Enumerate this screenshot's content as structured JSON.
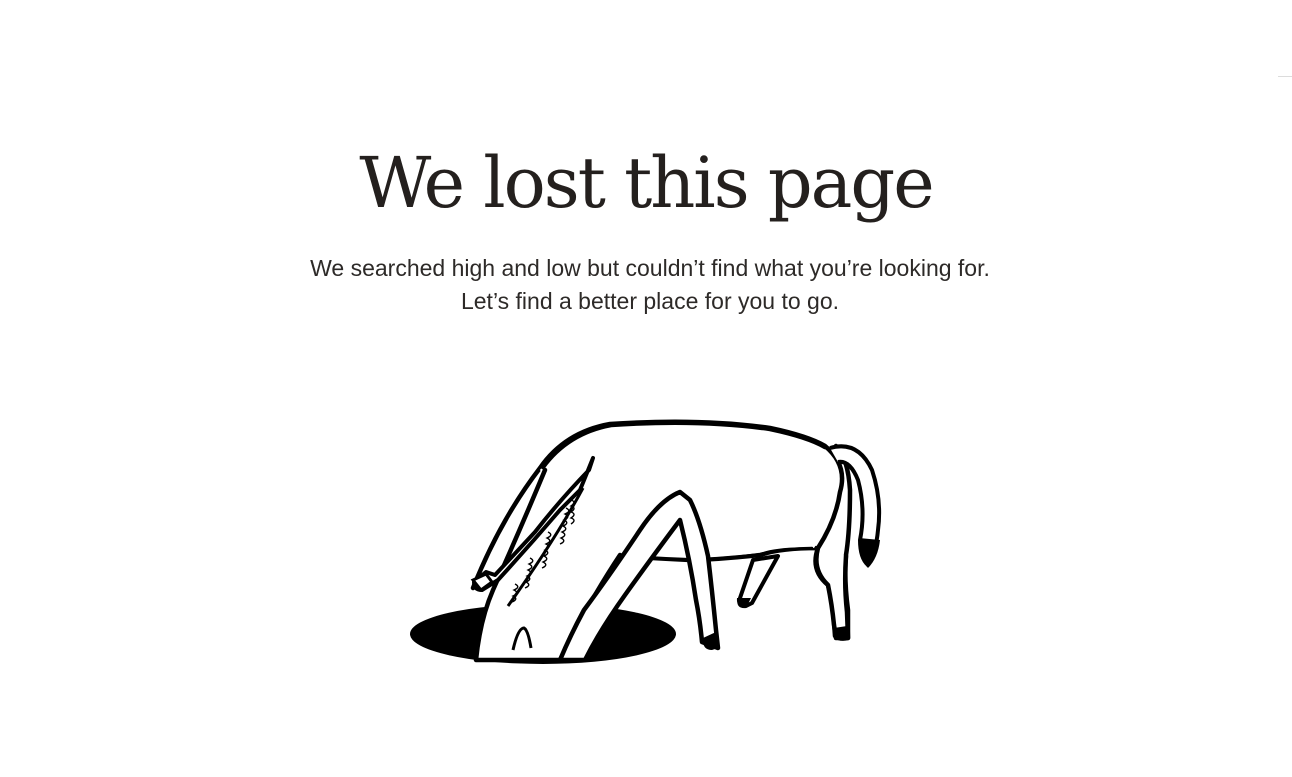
{
  "page": {
    "title": "We lost this page",
    "message": "We searched high and low but couldn’t find what you’re looking for. Let’s find a better place for you to go."
  },
  "illustration": {
    "icon": "anteater-in-hole-illustration",
    "ink_color": "#000000",
    "fill_color": "#ffffff"
  }
}
